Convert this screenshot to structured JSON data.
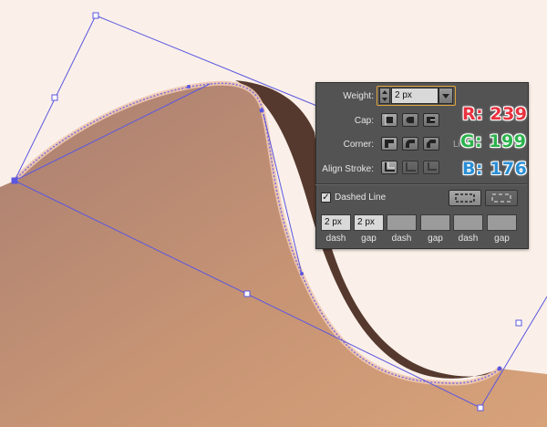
{
  "panel": {
    "weight_label": "Weight:",
    "weight_value": "2 px",
    "cap_label": "Cap:",
    "corner_label": "Corner:",
    "limit_label": "Li",
    "align_label": "Align Stroke:",
    "dashed_label": "Dashed Line",
    "dashed_checked": "✓",
    "dash_values": [
      "2 px",
      "2 px",
      "",
      "",
      "",
      ""
    ],
    "dash_labels": [
      "dash",
      "gap",
      "dash",
      "gap",
      "dash",
      "gap"
    ]
  },
  "color_readout": {
    "r": "R: 239",
    "g": "G: 199",
    "b": "B: 176",
    "r_color": "#e8313f",
    "g_color": "#2bb24c",
    "b_color": "#2a8fd6"
  },
  "colors": {
    "background": "#faf0e9",
    "selection": "#5b57e0",
    "shape_dark": "#56392e",
    "stroke_highlight": "#efc7b0",
    "panel": "#535353"
  }
}
